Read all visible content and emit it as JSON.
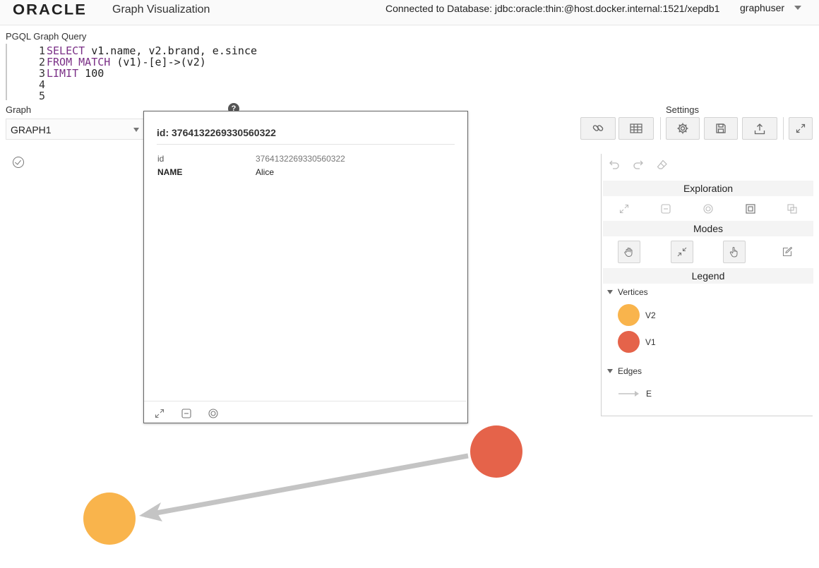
{
  "header": {
    "logo": "ORACLE",
    "app_title": "Graph Visualization",
    "connection": "Connected to Database: jdbc:oracle:thin:@host.docker.internal:1521/xepdb1",
    "user": "graphuser"
  },
  "query": {
    "label": "PGQL Graph Query",
    "lines": [
      {
        "num": "1",
        "kw": "SELECT",
        "rest": " v1.name, v2.brand, e.since"
      },
      {
        "num": "2",
        "kw": "FROM MATCH",
        "rest": " (v1)-[e]->(v2)"
      },
      {
        "num": "3",
        "kw": "LIMIT",
        "rest": " 100"
      },
      {
        "num": "4",
        "kw": "",
        "rest": ""
      },
      {
        "num": "5",
        "kw": "",
        "rest": ""
      }
    ]
  },
  "graph": {
    "label": "Graph",
    "selected": "GRAPH1"
  },
  "settings": {
    "label": "Settings"
  },
  "panel": {
    "exploration_title": "Exploration",
    "modes_title": "Modes",
    "legend_title": "Legend",
    "vertices_label": "Vertices",
    "edges_label": "Edges",
    "legend_vertices": [
      {
        "label": "V2",
        "color": "#f9b44c"
      },
      {
        "label": "V1",
        "color": "#e5634a"
      }
    ],
    "legend_edges": [
      {
        "label": "E"
      }
    ]
  },
  "popup": {
    "title": "id: 3764132269330560322",
    "properties": [
      {
        "key": "id",
        "value": "3764132269330560322"
      },
      {
        "key": "NAME",
        "value": "Alice"
      }
    ]
  },
  "colors": {
    "v1": "#e5634a",
    "v2": "#f9b44c",
    "edge": "#c4c4c4"
  }
}
